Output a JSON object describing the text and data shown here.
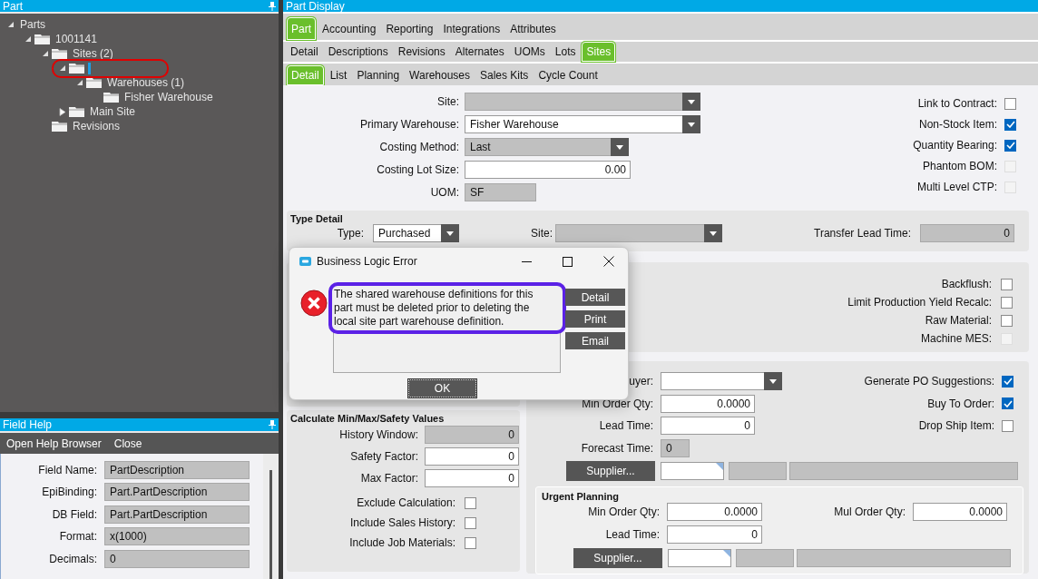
{
  "part_panel": {
    "title": "Part",
    "tree": [
      {
        "label": "Parts",
        "kind": "plain",
        "expanded": true,
        "children": [
          {
            "label": "1001141",
            "kind": "folder",
            "expanded": true,
            "children": [
              {
                "label": "Sites (2)",
                "kind": "folder",
                "expanded": true,
                "children": [
                  {
                    "kind": "folder",
                    "expanded": true,
                    "editing": true,
                    "highlighted": true,
                    "children": [
                      {
                        "label": "Warehouses (1)",
                        "kind": "folder",
                        "expanded": true,
                        "children": [
                          {
                            "label": "Fisher Warehouse",
                            "kind": "folder"
                          }
                        ]
                      }
                    ]
                  },
                  {
                    "label": "Main Site",
                    "kind": "folder",
                    "expanded": false
                  }
                ]
              },
              {
                "label": "Revisions",
                "kind": "folder"
              }
            ]
          }
        ]
      }
    ]
  },
  "field_help": {
    "title": "Field Help",
    "toolbar": [
      "Open Help Browser",
      "Close"
    ],
    "fields": [
      {
        "label": "Field Name:",
        "value": "PartDescription"
      },
      {
        "label": "EpiBinding:",
        "value": "Part.PartDescription"
      },
      {
        "label": "DB Field:",
        "value": "Part.PartDescription"
      },
      {
        "label": "Format:",
        "value": "x(1000)"
      },
      {
        "label": "Decimals:",
        "value": "0"
      }
    ]
  },
  "part_display": {
    "title": "Part Display",
    "tab_rows": [
      [
        {
          "label": "Part",
          "selected": true
        },
        {
          "label": "Accounting",
          "selected": false
        },
        {
          "label": "Reporting",
          "selected": false
        },
        {
          "label": "Integrations",
          "selected": false
        },
        {
          "label": "Attributes",
          "selected": false
        }
      ],
      [
        {
          "label": "Detail",
          "selected": false
        },
        {
          "label": "Descriptions",
          "selected": false
        },
        {
          "label": "Revisions",
          "selected": false
        },
        {
          "label": "Alternates",
          "selected": false
        },
        {
          "label": "UOMs",
          "selected": false
        },
        {
          "label": "Lots",
          "selected": false
        },
        {
          "label": "Sites",
          "selected": true
        }
      ],
      [
        {
          "label": "Detail",
          "selected": true
        },
        {
          "label": "List",
          "selected": false
        },
        {
          "label": "Planning",
          "selected": false
        },
        {
          "label": "Warehouses",
          "selected": false
        },
        {
          "label": "Sales Kits",
          "selected": false
        },
        {
          "label": "Cycle Count",
          "selected": false
        }
      ]
    ],
    "site_fields": [
      {
        "label": "Site:",
        "kind": "combo",
        "disabled": true
      },
      {
        "label": "Primary Warehouse:",
        "kind": "combo",
        "disabled": false,
        "value": "Fisher Warehouse"
      },
      {
        "label": "Costing Method:",
        "kind": "combo",
        "disabled": true,
        "value": "Last"
      },
      {
        "label": "Costing Lot Size:",
        "kind": "number",
        "disabled": false,
        "value": "0.00"
      },
      {
        "label": "UOM:",
        "kind": "text",
        "disabled": true,
        "value": "SF"
      }
    ],
    "site_checks": [
      {
        "label": "Link to Contract:",
        "checked": false,
        "disabled": false
      },
      {
        "label": "Non-Stock Item:",
        "checked": true,
        "disabled": false
      },
      {
        "label": "Quantity Bearing:",
        "checked": true,
        "disabled": false
      },
      {
        "label": "Phantom BOM:",
        "checked": false,
        "disabled": true
      },
      {
        "label": "Multi Level CTP:",
        "checked": false,
        "disabled": true
      }
    ],
    "type_detail": {
      "title": "Type Detail",
      "type": {
        "label": "Type:",
        "kind": "combo",
        "disabled": false,
        "value": "Purchased"
      },
      "site": {
        "label": "Site:",
        "kind": "combo",
        "disabled": true
      },
      "transfer_lead_time": {
        "label": "Transfer Lead Time:",
        "kind": "number",
        "disabled": true,
        "value": "0"
      }
    },
    "production_checks": [
      {
        "label": "Backflush:",
        "checked": false,
        "disabled": false
      },
      {
        "label": "Limit Production Yield Recalc:",
        "checked": false,
        "disabled": false
      },
      {
        "label": "Raw Material:",
        "checked": false,
        "disabled": false
      },
      {
        "label": "Machine MES:",
        "checked": false,
        "disabled": true
      }
    ],
    "calculate": {
      "title": "Calculate Min/Max/Safety Values",
      "fields": [
        {
          "label": "History Window:",
          "kind": "number",
          "disabled": true,
          "value": "0"
        },
        {
          "label": "Safety Factor:",
          "kind": "number",
          "disabled": false,
          "value": "0"
        },
        {
          "label": "Max Factor:",
          "kind": "number",
          "disabled": false,
          "value": "0"
        }
      ],
      "checks": [
        {
          "label": "Exclude Calculation:",
          "checked": false,
          "disabled": false
        },
        {
          "label": "Include Sales History:",
          "checked": false,
          "disabled": false
        },
        {
          "label": "Include Job Materials:",
          "checked": false,
          "disabled": false
        }
      ]
    },
    "purchasing": {
      "fields": [
        {
          "label": "uyer:",
          "kind": "combo",
          "disabled": false
        },
        {
          "label": "Min Order Qty:",
          "kind": "number",
          "disabled": false,
          "value": "0.0000"
        },
        {
          "label": "Lead Time:",
          "kind": "number",
          "disabled": false,
          "value": "0"
        },
        {
          "label": "Forecast Time:",
          "kind": "text",
          "disabled": true,
          "value": "0"
        }
      ],
      "checks": [
        {
          "label": "Generate PO Suggestions:",
          "checked": true,
          "disabled": false
        },
        {
          "label": "Buy To Order:",
          "checked": true,
          "disabled": false
        },
        {
          "label": "Drop Ship Item:",
          "checked": false,
          "disabled": false
        }
      ],
      "supplier_button": "Supplier..."
    },
    "urgent_planning": {
      "title": "Urgent Planning",
      "min_order_qty": {
        "label": "Min Order Qty:",
        "kind": "number",
        "disabled": false,
        "value": "0.0000"
      },
      "mul_order_qty": {
        "label": "Mul Order Qty:",
        "kind": "number",
        "disabled": false,
        "value": "0.0000"
      },
      "lead_time": {
        "label": "Lead Time:",
        "kind": "number",
        "disabled": false,
        "value": "0"
      },
      "supplier_button": "Supplier..."
    }
  },
  "dialog": {
    "title": "Business Logic Error",
    "message": "The shared warehouse definitions for this part must be deleted prior to deleting the local site part warehouse definition.",
    "highlighted": true,
    "buttons": [
      "Detail",
      "Print",
      "Email"
    ],
    "ok": "OK"
  }
}
